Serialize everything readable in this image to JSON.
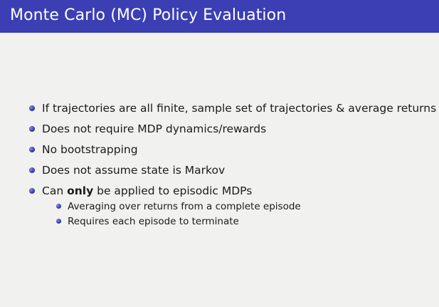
{
  "slide": {
    "title": "Monte Carlo (MC) Policy Evaluation",
    "bullets": [
      {
        "text": "If trajectories are all finite, sample set of trajectories & average returns"
      },
      {
        "text": "Does not require MDP dynamics/rewards"
      },
      {
        "text": "No bootstrapping"
      },
      {
        "text": "Does not assume state is Markov"
      },
      {
        "pre": "Can ",
        "bold": "only",
        "post": " be applied to episodic MDPs"
      }
    ],
    "subbullets": [
      "Averaging over returns from a complete episode",
      "Requires each episode to terminate"
    ]
  },
  "colors": {
    "title_bar": "#3b3fb3",
    "background": "#f1f1ef",
    "bullet": "#3a3da8"
  }
}
